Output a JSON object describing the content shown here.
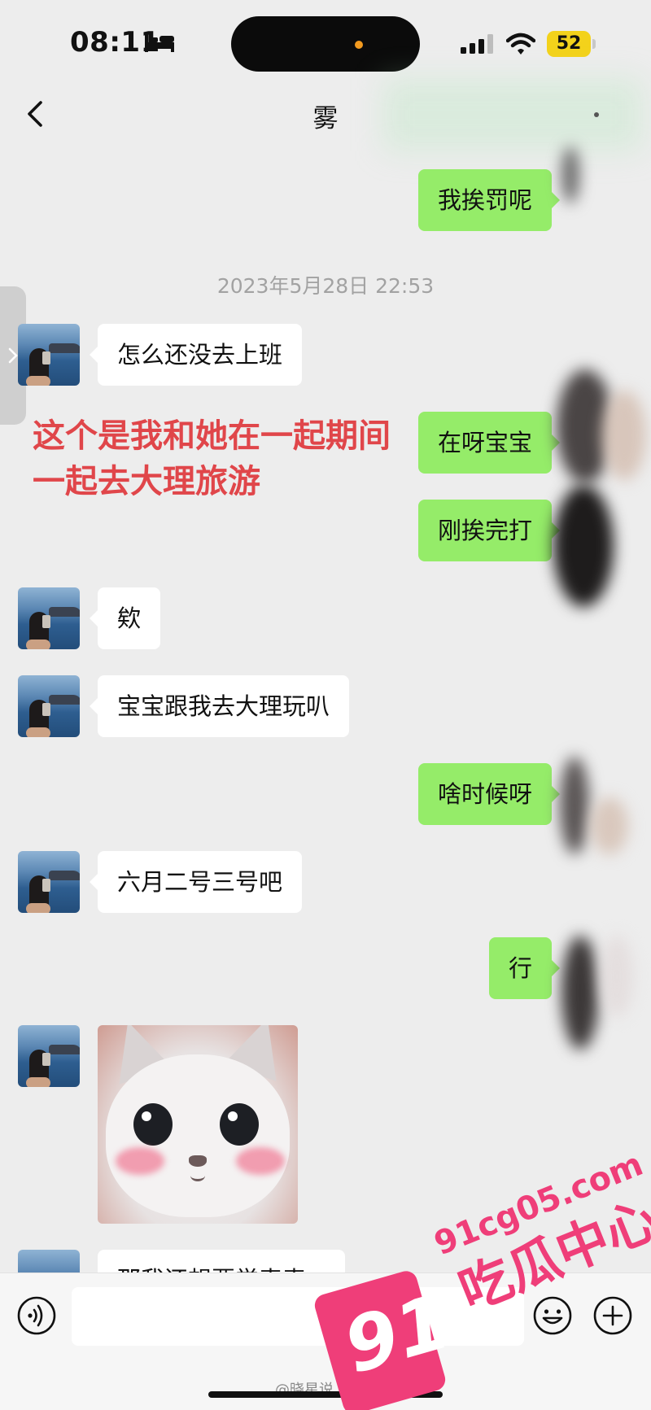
{
  "status_bar": {
    "time": "08:11",
    "battery": "52",
    "icons": [
      "bed-icon",
      "signal-icon",
      "wifi-icon",
      "battery-icon"
    ]
  },
  "nav": {
    "title": "雾",
    "back_icon": "chevron-left-icon"
  },
  "timestamp": "2023年5月28日 22:53",
  "messages": [
    {
      "side": "right",
      "text": "我挨罚呢"
    },
    {
      "side": "left",
      "text": "怎么还没去上班"
    },
    {
      "side": "right",
      "text": "在呀宝宝"
    },
    {
      "side": "right",
      "text": "刚挨完打"
    },
    {
      "side": "left",
      "text": "欸"
    },
    {
      "side": "left",
      "text": "宝宝跟我去大理玩叭"
    },
    {
      "side": "right",
      "text": "啥时候呀"
    },
    {
      "side": "left",
      "text": "六月二号三号吧"
    },
    {
      "side": "right",
      "text": "行"
    },
    {
      "side": "left",
      "type": "sticker",
      "sticker": "cat-sticker"
    },
    {
      "side": "left",
      "text": "那我还想要学表表",
      "partial": true
    }
  ],
  "annotation": {
    "line1": "这个是我和她在一起期间",
    "line2": "一起去大理旅游",
    "color": "#e0464a"
  },
  "input_bar": {
    "icons": [
      "voice-icon",
      "emoji-icon",
      "plus-icon"
    ]
  },
  "credit": "@晓星说",
  "watermark": {
    "logo": "91",
    "url": "91cg05.com",
    "name": "吃瓜中心",
    "color": "#ef3e79"
  },
  "colors": {
    "background": "#ededed",
    "incoming_bubble": "#ffffff",
    "outgoing_bubble": "#95ec69"
  }
}
